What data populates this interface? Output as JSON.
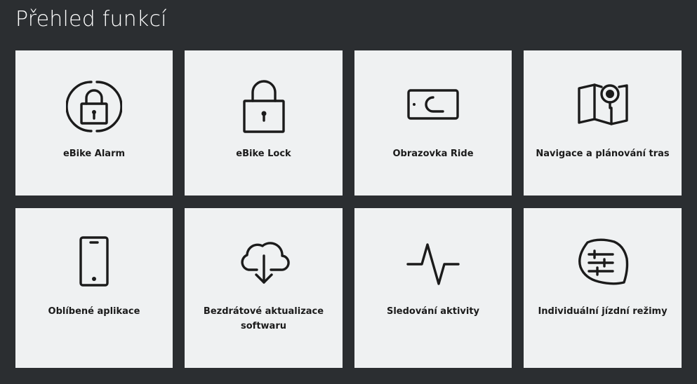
{
  "page": {
    "title": "Přehled funkcí"
  },
  "features": [
    {
      "label": "eBike Alarm",
      "icon": "alarm-lock-icon"
    },
    {
      "label": "eBike Lock",
      "icon": "padlock-icon"
    },
    {
      "label": "Obrazovka Ride",
      "icon": "ride-screen-icon"
    },
    {
      "label": "Navigace a plánování tras",
      "icon": "map-pin-icon"
    },
    {
      "label": "Oblíbené aplikace",
      "icon": "smartphone-icon"
    },
    {
      "label": "Bezdrátové aktualizace softwaru",
      "icon": "cloud-download-icon"
    },
    {
      "label": "Sledování aktivity",
      "icon": "activity-pulse-icon"
    },
    {
      "label": "Individuální jízdní režimy",
      "icon": "sliders-icon"
    }
  ],
  "colors": {
    "background": "#2b2e31",
    "tile": "#eff1f2",
    "text": "#1b1b1b",
    "title": "#ffffff"
  }
}
